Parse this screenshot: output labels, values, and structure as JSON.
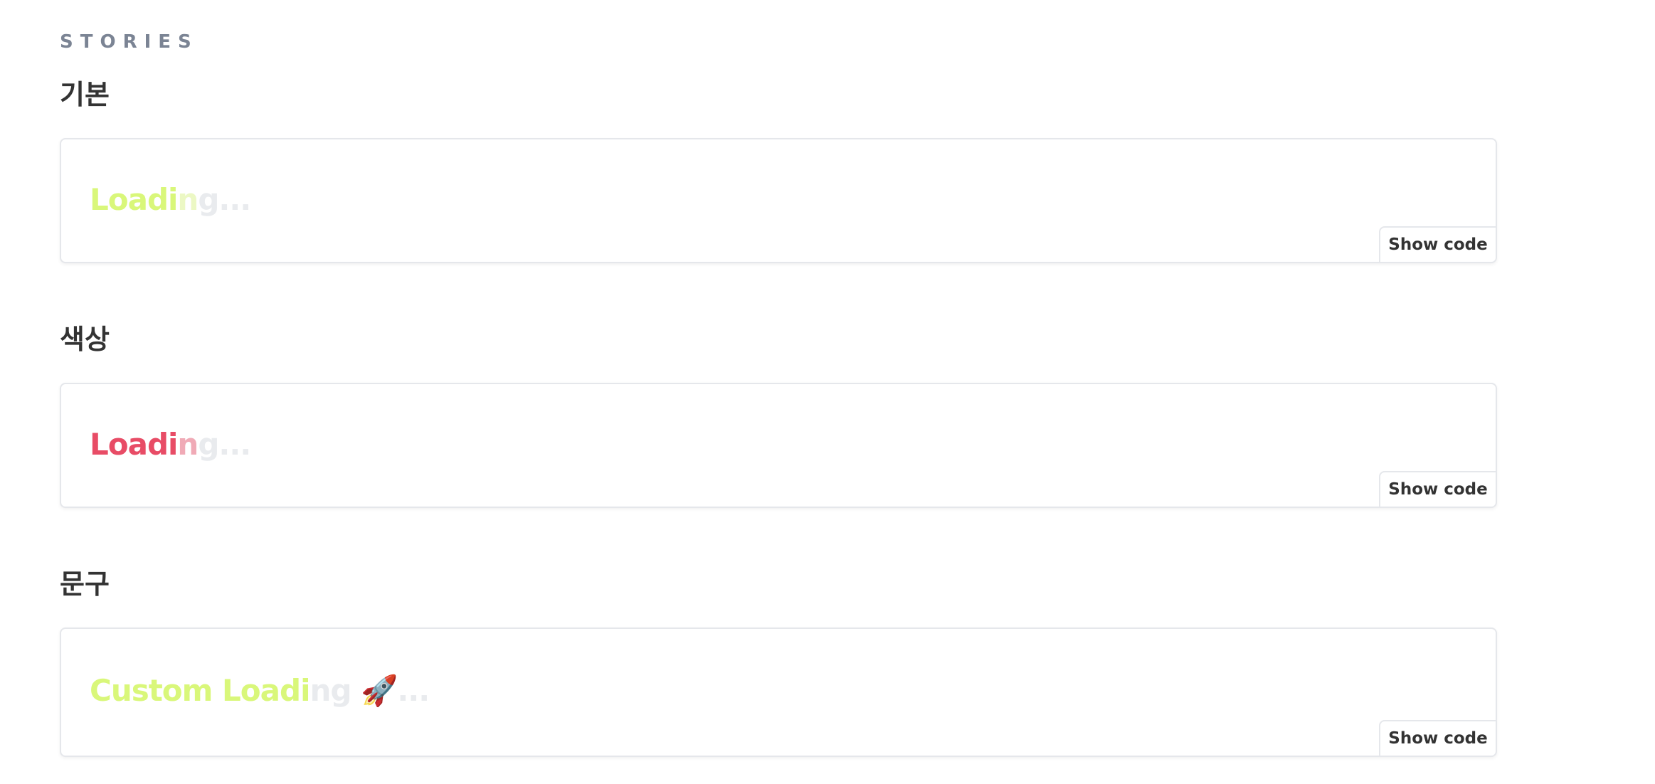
{
  "section_label": "STORIES",
  "colors": {
    "accent_lime": "#d9f77a",
    "accent_red": "#e84c66",
    "faded": "#e9ebee"
  },
  "stories": [
    {
      "title": "기본",
      "loading_lit": "Loadi",
      "loading_lit_partial": "n",
      "loading_dim": "g...",
      "show_code": "Show code"
    },
    {
      "title": "색상",
      "loading_lit": "Loadi",
      "loading_lit_partial": "n",
      "loading_dim": "g...",
      "show_code": "Show code"
    },
    {
      "title": "문구",
      "loading_lit": "Custom Loadi",
      "loading_lit_partial": "",
      "loading_dim": "ng 🚀...",
      "show_code": "Show code"
    }
  ]
}
